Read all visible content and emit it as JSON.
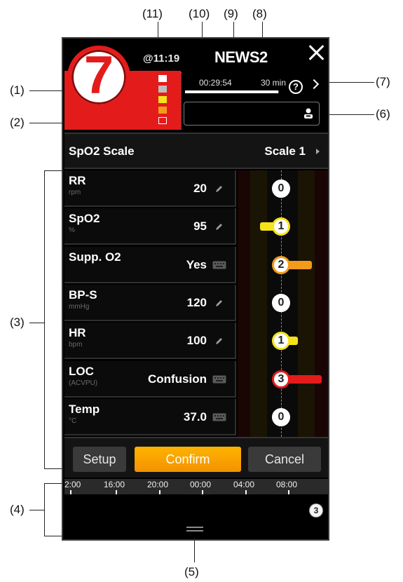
{
  "callouts": {
    "c1": "(1)",
    "c2": "(2)",
    "c3": "(3)",
    "c4": "(4)",
    "c5": "(5)",
    "c6": "(6)",
    "c7": "(7)",
    "c8": "(8)",
    "c9": "(9)",
    "c10": "(10)",
    "c11": "(11)"
  },
  "header": {
    "time": "@11:19",
    "title": "NEWS2",
    "close_icon": "close-icon"
  },
  "score": {
    "total": "7",
    "color": "#e41b1b",
    "legend_colors": [
      "#ffffff",
      "#bdbdbd",
      "#f5e31a",
      "#f39a1a",
      "#e41b1b"
    ]
  },
  "timer": {
    "elapsed": "00:29:54",
    "interval": "30 min",
    "progress": 0.99
  },
  "patient": {
    "icon": "patient-icon"
  },
  "scale_row": {
    "label": "SpO2 Scale",
    "value": "Scale 1"
  },
  "params": [
    {
      "name": "RR",
      "unit": "rpm",
      "value": "20",
      "input": "edit-icon",
      "score": "0",
      "side": "none",
      "color": "#ffffff"
    },
    {
      "name": "SpO2",
      "unit": "%",
      "value": "95",
      "input": "edit-icon",
      "score": "1",
      "side": "left",
      "color": "#f5e31a"
    },
    {
      "name": "Supp. O2",
      "unit": "",
      "value": "Yes",
      "input": "keyboard-icon",
      "score": "2",
      "side": "right",
      "color": "#f39a1a"
    },
    {
      "name": "BP-S",
      "unit": "mmHg",
      "value": "120",
      "input": "edit-icon",
      "score": "0",
      "side": "none",
      "color": "#ffffff"
    },
    {
      "name": "HR",
      "unit": "bpm",
      "value": "100",
      "input": "edit-icon",
      "score": "1",
      "side": "right",
      "color": "#f5e31a"
    },
    {
      "name": "LOC",
      "unit": "(ACVPU)",
      "value": "Confusion",
      "input": "keyboard-icon",
      "score": "3",
      "side": "right",
      "color": "#e41b1b"
    },
    {
      "name": "Temp",
      "unit": "°C",
      "value": "37.0",
      "input": "keyboard-icon",
      "score": "0",
      "side": "none",
      "color": "#ffffff"
    }
  ],
  "buttons": {
    "setup": "Setup",
    "confirm": "Confirm",
    "cancel": "Cancel"
  },
  "timeline": {
    "labels": [
      "2:00",
      "16:00",
      "20:00",
      "00:00",
      "04:00",
      "08:00"
    ],
    "latest_score": "3"
  }
}
